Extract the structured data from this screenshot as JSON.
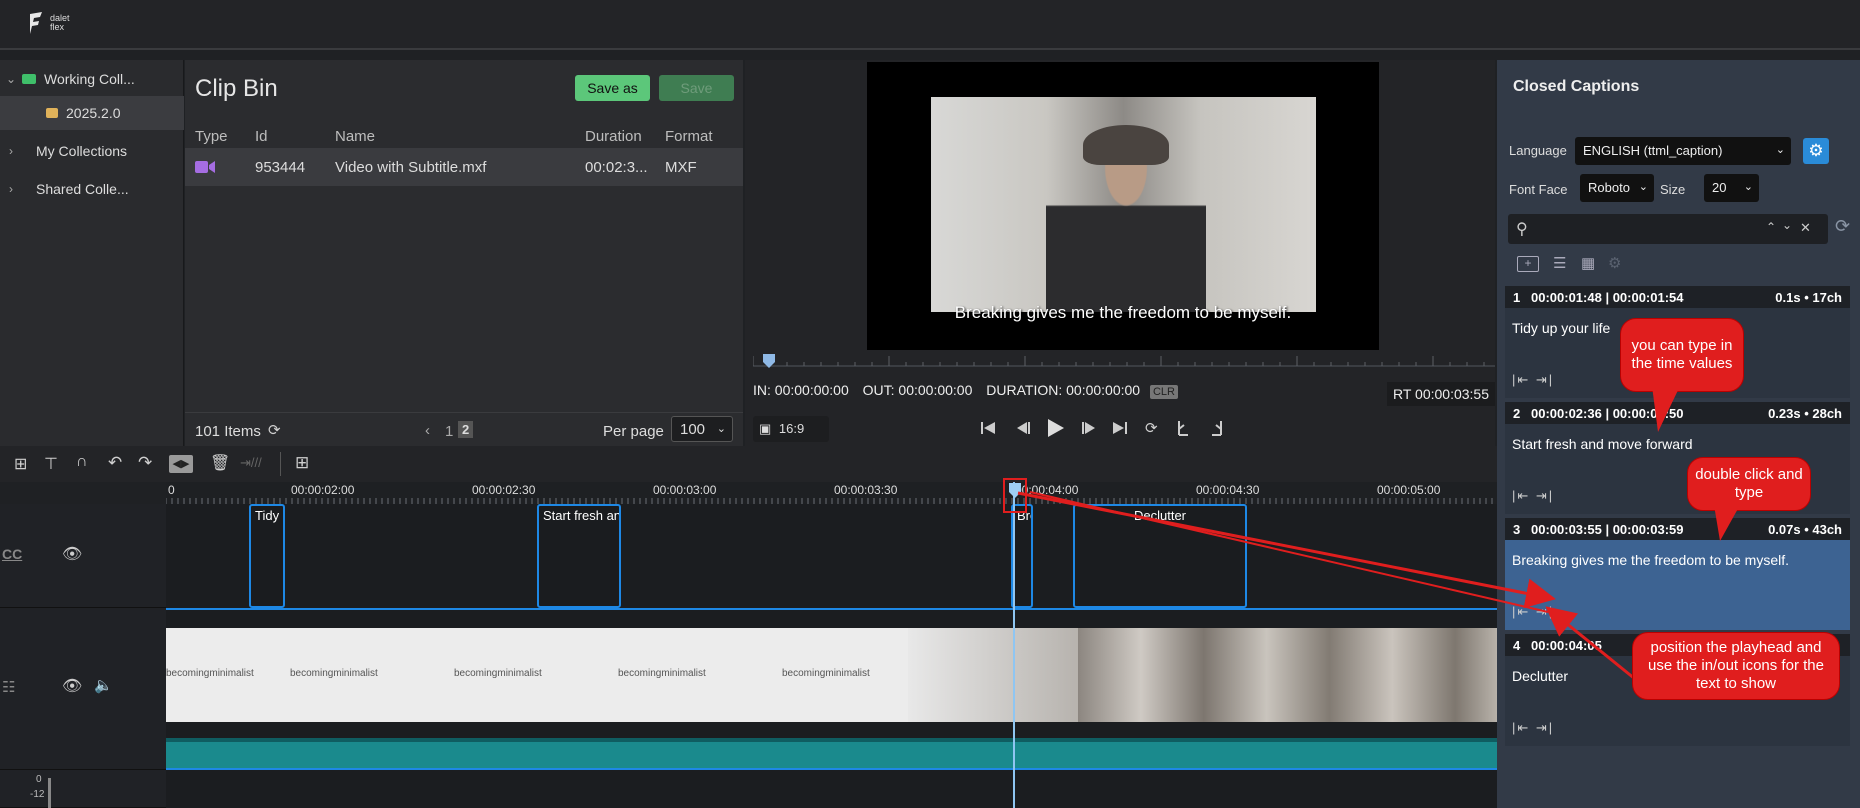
{
  "app": {
    "logo_line1": "dalet",
    "logo_line2": "flex"
  },
  "sidebar": {
    "items": [
      {
        "label": "Working Coll...",
        "expanded": true
      },
      {
        "label": "2025.2.0"
      },
      {
        "label": "My Collections"
      },
      {
        "label": "Shared Colle..."
      }
    ]
  },
  "clipbin": {
    "title": "Clip Bin",
    "save_as": "Save as",
    "save": "Save",
    "columns": [
      "Type",
      "Id",
      "Name",
      "Duration",
      "Format"
    ],
    "rows": [
      {
        "id": "953444",
        "name": "Video with Subtitle.mxf",
        "duration": "00:02:3...",
        "format": "MXF"
      }
    ],
    "items_count": "101 Items",
    "page1": "1",
    "page2": "2",
    "per_page_label": "Per page",
    "per_page_value": "100"
  },
  "viewer": {
    "subtitle": "Breaking gives me the freedom to be myself.",
    "in_label": "IN: 00:00:00:00",
    "out_label": "OUT: 00:00:00:00",
    "duration_label": "DURATION: 00:00:00:00",
    "clr": "CLR",
    "rt": "RT 00:00:03:55",
    "aspect": "16:9"
  },
  "captions_panel": {
    "title": "Closed Captions",
    "language_label": "Language",
    "language_value": "ENGLISH (ttml_caption)",
    "font_face_label": "Font Face",
    "font_face_value": "Roboto",
    "size_label": "Size",
    "size_value": "20",
    "captions": [
      {
        "num": "1",
        "times": "00:00:01:48 | 00:00:01:54",
        "stats": "0.1s • 17ch",
        "text": "Tidy up your life"
      },
      {
        "num": "2",
        "times": "00:00:02:36 | 00:00:02:50",
        "stats": "0.23s • 28ch",
        "text": "Start fresh and move forward"
      },
      {
        "num": "3",
        "times": "00:00:03:55 | 00:00:03:59",
        "stats": "0.07s • 43ch",
        "text": "Breaking gives me the freedom to be myself."
      },
      {
        "num": "4",
        "times": "00:00:04:05",
        "stats": "",
        "text": "Declutter"
      }
    ]
  },
  "timeline": {
    "ruler_labels": [
      "0",
      "00:00:02:00",
      "00:00:02:30",
      "00:00:03:00",
      "00:00:03:30",
      "00:00:04:00",
      "00:00:04:30",
      "00:00:05:00"
    ],
    "cc_track_label": "CC",
    "clips": [
      "Tidy u",
      "Start fresh and",
      "Brea",
      "Declutter"
    ],
    "watermark": "becomingminimalist",
    "meter_labels": [
      "0",
      "-12"
    ]
  },
  "callouts": {
    "c1": "you can type in the time values",
    "c2": "double click and type",
    "c3": "position the playhead and use the in/out icons for the text to show"
  },
  "colors": {
    "accent_blue": "#1e88e5",
    "green": "#5cc77a",
    "callout_red": "#e01e1e",
    "active_card": "#3d6392"
  }
}
